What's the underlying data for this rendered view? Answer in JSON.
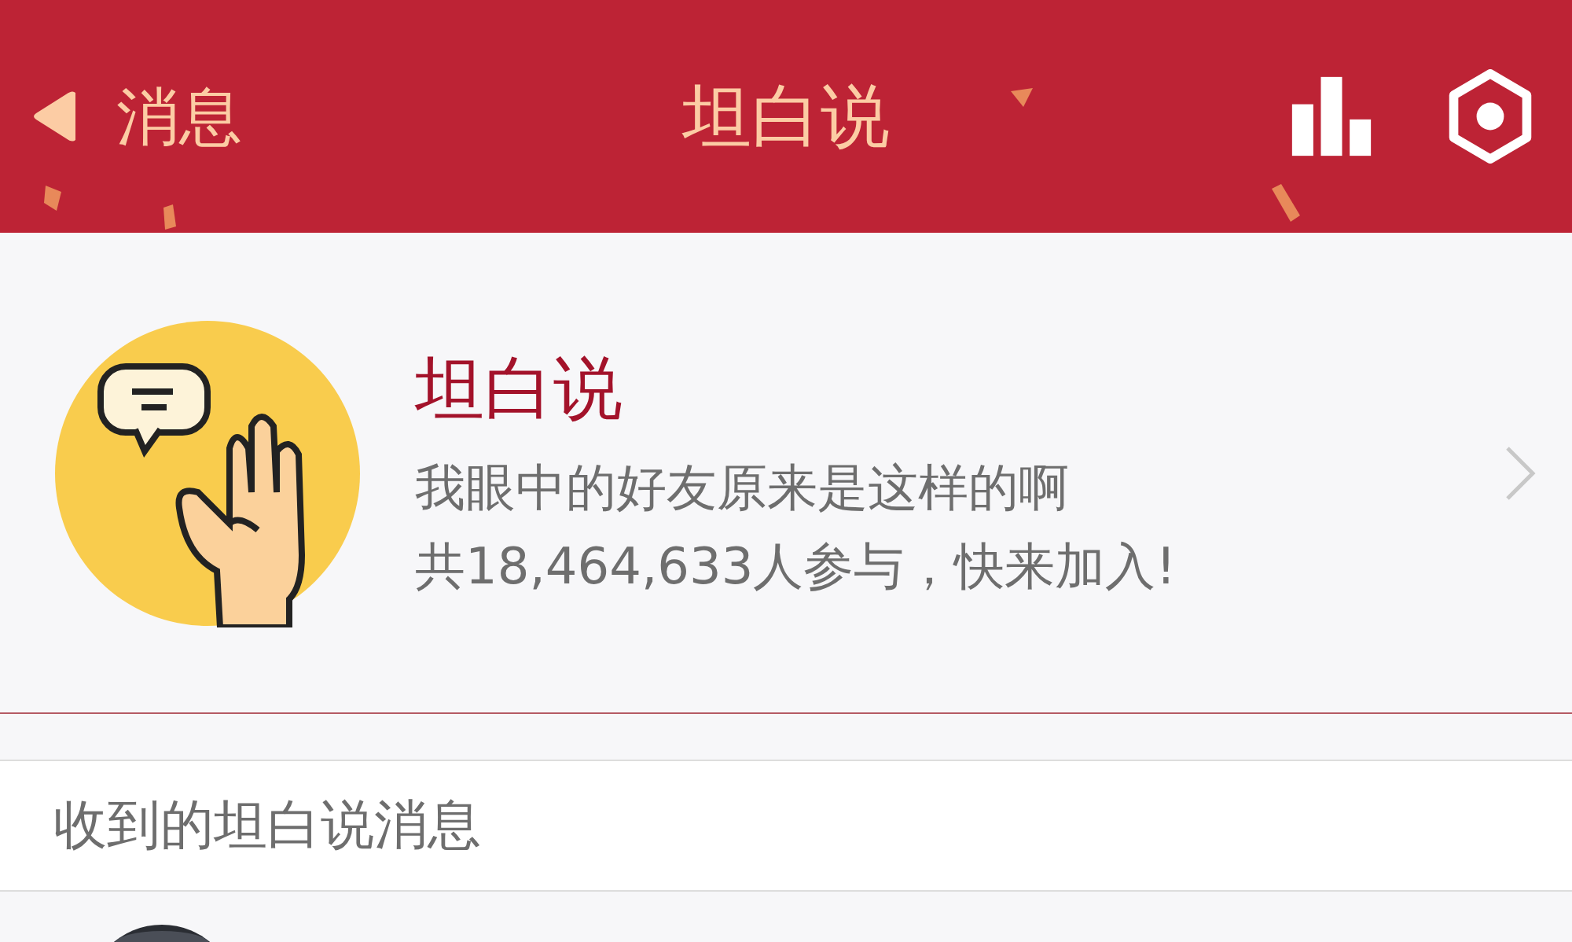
{
  "header": {
    "back_label": "消息",
    "title": "坦白说"
  },
  "feature": {
    "title": "坦白说",
    "subtitle": "我眼中的好友原来是这样的啊",
    "participants": "共18,464,633人参与，快来加入!"
  },
  "received": {
    "title": "收到的坦白说消息"
  }
}
